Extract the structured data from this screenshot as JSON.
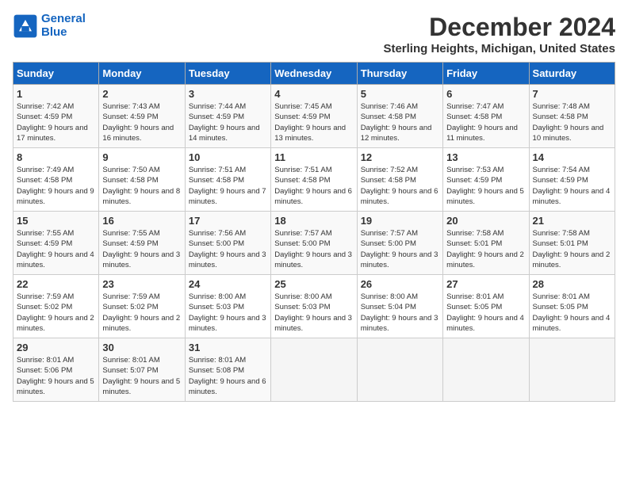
{
  "header": {
    "logo_line1": "General",
    "logo_line2": "Blue",
    "month": "December 2024",
    "location": "Sterling Heights, Michigan, United States"
  },
  "weekdays": [
    "Sunday",
    "Monday",
    "Tuesday",
    "Wednesday",
    "Thursday",
    "Friday",
    "Saturday"
  ],
  "weeks": [
    [
      {
        "day": "1",
        "sunrise": "Sunrise: 7:42 AM",
        "sunset": "Sunset: 4:59 PM",
        "daylight": "Daylight: 9 hours and 17 minutes."
      },
      {
        "day": "2",
        "sunrise": "Sunrise: 7:43 AM",
        "sunset": "Sunset: 4:59 PM",
        "daylight": "Daylight: 9 hours and 16 minutes."
      },
      {
        "day": "3",
        "sunrise": "Sunrise: 7:44 AM",
        "sunset": "Sunset: 4:59 PM",
        "daylight": "Daylight: 9 hours and 14 minutes."
      },
      {
        "day": "4",
        "sunrise": "Sunrise: 7:45 AM",
        "sunset": "Sunset: 4:59 PM",
        "daylight": "Daylight: 9 hours and 13 minutes."
      },
      {
        "day": "5",
        "sunrise": "Sunrise: 7:46 AM",
        "sunset": "Sunset: 4:58 PM",
        "daylight": "Daylight: 9 hours and 12 minutes."
      },
      {
        "day": "6",
        "sunrise": "Sunrise: 7:47 AM",
        "sunset": "Sunset: 4:58 PM",
        "daylight": "Daylight: 9 hours and 11 minutes."
      },
      {
        "day": "7",
        "sunrise": "Sunrise: 7:48 AM",
        "sunset": "Sunset: 4:58 PM",
        "daylight": "Daylight: 9 hours and 10 minutes."
      }
    ],
    [
      {
        "day": "8",
        "sunrise": "Sunrise: 7:49 AM",
        "sunset": "Sunset: 4:58 PM",
        "daylight": "Daylight: 9 hours and 9 minutes."
      },
      {
        "day": "9",
        "sunrise": "Sunrise: 7:50 AM",
        "sunset": "Sunset: 4:58 PM",
        "daylight": "Daylight: 9 hours and 8 minutes."
      },
      {
        "day": "10",
        "sunrise": "Sunrise: 7:51 AM",
        "sunset": "Sunset: 4:58 PM",
        "daylight": "Daylight: 9 hours and 7 minutes."
      },
      {
        "day": "11",
        "sunrise": "Sunrise: 7:51 AM",
        "sunset": "Sunset: 4:58 PM",
        "daylight": "Daylight: 9 hours and 6 minutes."
      },
      {
        "day": "12",
        "sunrise": "Sunrise: 7:52 AM",
        "sunset": "Sunset: 4:58 PM",
        "daylight": "Daylight: 9 hours and 6 minutes."
      },
      {
        "day": "13",
        "sunrise": "Sunrise: 7:53 AM",
        "sunset": "Sunset: 4:59 PM",
        "daylight": "Daylight: 9 hours and 5 minutes."
      },
      {
        "day": "14",
        "sunrise": "Sunrise: 7:54 AM",
        "sunset": "Sunset: 4:59 PM",
        "daylight": "Daylight: 9 hours and 4 minutes."
      }
    ],
    [
      {
        "day": "15",
        "sunrise": "Sunrise: 7:55 AM",
        "sunset": "Sunset: 4:59 PM",
        "daylight": "Daylight: 9 hours and 4 minutes."
      },
      {
        "day": "16",
        "sunrise": "Sunrise: 7:55 AM",
        "sunset": "Sunset: 4:59 PM",
        "daylight": "Daylight: 9 hours and 3 minutes."
      },
      {
        "day": "17",
        "sunrise": "Sunrise: 7:56 AM",
        "sunset": "Sunset: 5:00 PM",
        "daylight": "Daylight: 9 hours and 3 minutes."
      },
      {
        "day": "18",
        "sunrise": "Sunrise: 7:57 AM",
        "sunset": "Sunset: 5:00 PM",
        "daylight": "Daylight: 9 hours and 3 minutes."
      },
      {
        "day": "19",
        "sunrise": "Sunrise: 7:57 AM",
        "sunset": "Sunset: 5:00 PM",
        "daylight": "Daylight: 9 hours and 3 minutes."
      },
      {
        "day": "20",
        "sunrise": "Sunrise: 7:58 AM",
        "sunset": "Sunset: 5:01 PM",
        "daylight": "Daylight: 9 hours and 2 minutes."
      },
      {
        "day": "21",
        "sunrise": "Sunrise: 7:58 AM",
        "sunset": "Sunset: 5:01 PM",
        "daylight": "Daylight: 9 hours and 2 minutes."
      }
    ],
    [
      {
        "day": "22",
        "sunrise": "Sunrise: 7:59 AM",
        "sunset": "Sunset: 5:02 PM",
        "daylight": "Daylight: 9 hours and 2 minutes."
      },
      {
        "day": "23",
        "sunrise": "Sunrise: 7:59 AM",
        "sunset": "Sunset: 5:02 PM",
        "daylight": "Daylight: 9 hours and 2 minutes."
      },
      {
        "day": "24",
        "sunrise": "Sunrise: 8:00 AM",
        "sunset": "Sunset: 5:03 PM",
        "daylight": "Daylight: 9 hours and 3 minutes."
      },
      {
        "day": "25",
        "sunrise": "Sunrise: 8:00 AM",
        "sunset": "Sunset: 5:03 PM",
        "daylight": "Daylight: 9 hours and 3 minutes."
      },
      {
        "day": "26",
        "sunrise": "Sunrise: 8:00 AM",
        "sunset": "Sunset: 5:04 PM",
        "daylight": "Daylight: 9 hours and 3 minutes."
      },
      {
        "day": "27",
        "sunrise": "Sunrise: 8:01 AM",
        "sunset": "Sunset: 5:05 PM",
        "daylight": "Daylight: 9 hours and 4 minutes."
      },
      {
        "day": "28",
        "sunrise": "Sunrise: 8:01 AM",
        "sunset": "Sunset: 5:05 PM",
        "daylight": "Daylight: 9 hours and 4 minutes."
      }
    ],
    [
      {
        "day": "29",
        "sunrise": "Sunrise: 8:01 AM",
        "sunset": "Sunset: 5:06 PM",
        "daylight": "Daylight: 9 hours and 5 minutes."
      },
      {
        "day": "30",
        "sunrise": "Sunrise: 8:01 AM",
        "sunset": "Sunset: 5:07 PM",
        "daylight": "Daylight: 9 hours and 5 minutes."
      },
      {
        "day": "31",
        "sunrise": "Sunrise: 8:01 AM",
        "sunset": "Sunset: 5:08 PM",
        "daylight": "Daylight: 9 hours and 6 minutes."
      },
      null,
      null,
      null,
      null
    ]
  ]
}
